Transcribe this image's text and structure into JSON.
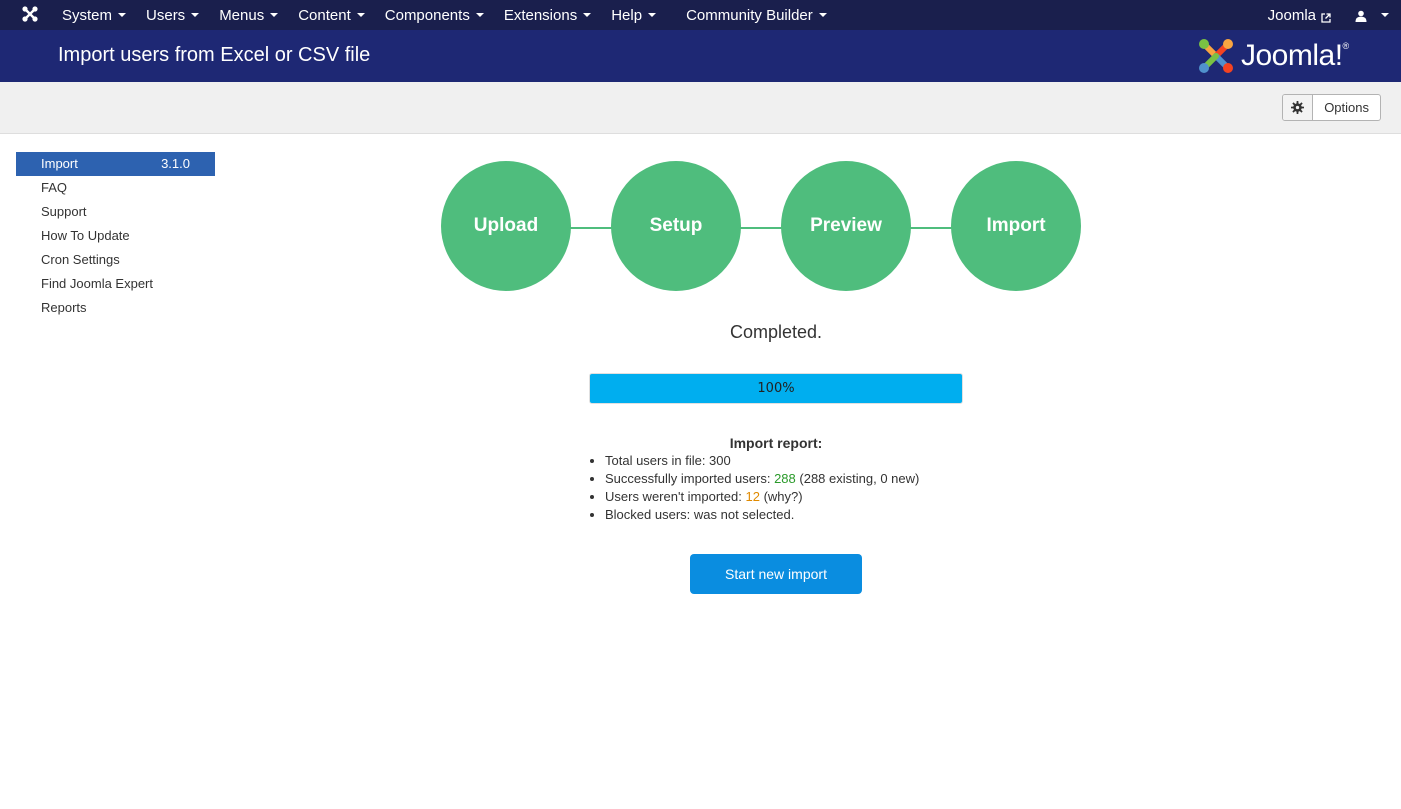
{
  "navbar": {
    "menus": [
      {
        "label": "System"
      },
      {
        "label": "Users"
      },
      {
        "label": "Menus"
      },
      {
        "label": "Content"
      },
      {
        "label": "Components"
      },
      {
        "label": "Extensions"
      },
      {
        "label": "Help"
      }
    ],
    "community_builder": "Community Builder",
    "site_link": "Joomla",
    "icons": {
      "brand": "joomla-icon",
      "external": "external-link-icon",
      "user": "user-icon"
    }
  },
  "header": {
    "title": "Import users from Excel or CSV file",
    "logo_text": "Joomla!"
  },
  "toolbar": {
    "options_label": "Options"
  },
  "sidebar": {
    "items": [
      {
        "label": "Import",
        "version": "3.1.0",
        "active": true
      },
      {
        "label": "FAQ"
      },
      {
        "label": "Support"
      },
      {
        "label": "How To Update"
      },
      {
        "label": "Cron Settings"
      },
      {
        "label": "Find Joomla Expert"
      },
      {
        "label": "Reports"
      }
    ]
  },
  "steps": [
    "Upload",
    "Setup",
    "Preview",
    "Import"
  ],
  "status": "Completed.",
  "progress": {
    "percent": 100,
    "label": "100%"
  },
  "report": {
    "title": "Import report:",
    "total_prefix": "Total users in file: ",
    "total_value": "300",
    "success_prefix": "Successfully imported users: ",
    "success_value": "288",
    "success_suffix": " (288 existing, 0 new)",
    "failed_prefix": "Users weren't imported: ",
    "failed_value": "12",
    "failed_suffix": " (why?)",
    "blocked": "Blocked users: was not selected."
  },
  "start_button": "Start new import",
  "colors": {
    "navbar": "#1a1f4d",
    "header": "#1e2874",
    "step": "#4fbd7d",
    "progress": "#00aeef",
    "active_sidebar": "#2d62b0",
    "button": "#0a8de0",
    "success": "#2a9a2a",
    "warning": "#e08a00"
  }
}
